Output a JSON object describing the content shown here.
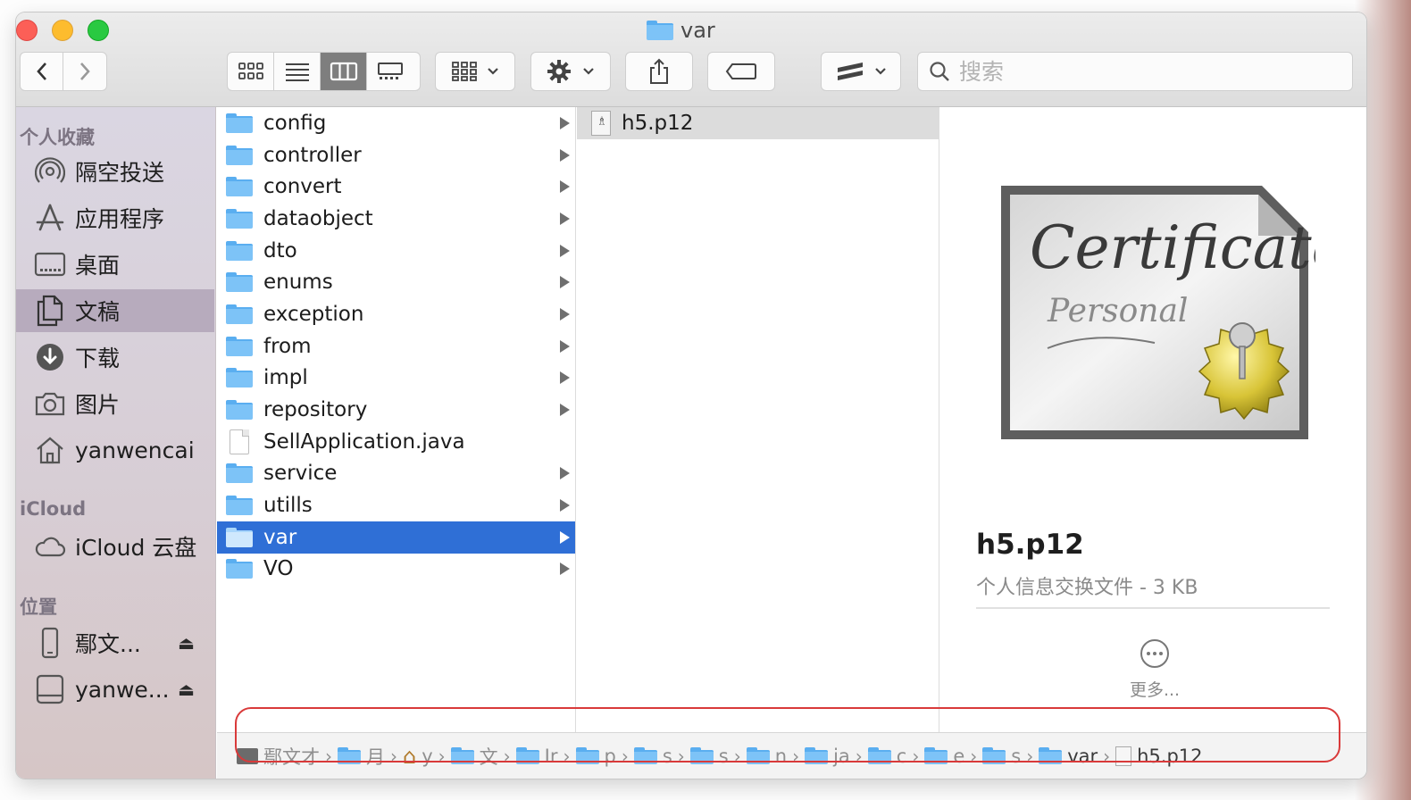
{
  "window": {
    "title": "var"
  },
  "toolbar": {
    "back_icon": "chevron-left-icon",
    "forward_icon": "chevron-right-icon",
    "search_placeholder": "搜索"
  },
  "sidebar": {
    "favorites_header": "个人收藏",
    "favorites": [
      {
        "label": "隔空投送",
        "icon": "airdrop-icon"
      },
      {
        "label": "应用程序",
        "icon": "applications-icon"
      },
      {
        "label": "桌面",
        "icon": "desktop-icon"
      },
      {
        "label": "文稿",
        "icon": "documents-icon",
        "selected": true
      },
      {
        "label": "下载",
        "icon": "downloads-icon"
      },
      {
        "label": "图片",
        "icon": "camera-icon"
      },
      {
        "label": "yanwencai",
        "icon": "home-icon"
      }
    ],
    "icloud_header": "iCloud",
    "icloud": [
      {
        "label": "iCloud 云盘",
        "icon": "cloud-icon"
      }
    ],
    "locations_header": "位置",
    "locations": [
      {
        "label": "鄢文...",
        "icon": "iphone-icon",
        "eject": "⏏"
      },
      {
        "label": "yanwe...",
        "icon": "disk-icon",
        "eject": "⏏"
      }
    ]
  },
  "column1": {
    "items": [
      {
        "label": "config",
        "type": "folder"
      },
      {
        "label": "controller",
        "type": "folder"
      },
      {
        "label": "convert",
        "type": "folder"
      },
      {
        "label": "dataobject",
        "type": "folder"
      },
      {
        "label": "dto",
        "type": "folder"
      },
      {
        "label": "enums",
        "type": "folder"
      },
      {
        "label": "exception",
        "type": "folder"
      },
      {
        "label": "from",
        "type": "folder"
      },
      {
        "label": "impl",
        "type": "folder"
      },
      {
        "label": "repository",
        "type": "folder"
      },
      {
        "label": "SellApplication.java",
        "type": "file"
      },
      {
        "label": "service",
        "type": "folder"
      },
      {
        "label": "utills",
        "type": "folder"
      },
      {
        "label": "var",
        "type": "folder",
        "selected": true
      },
      {
        "label": "VO",
        "type": "folder"
      }
    ]
  },
  "column2": {
    "items": [
      {
        "label": "h5.p12",
        "type": "certificate"
      }
    ]
  },
  "preview": {
    "filename": "h5.p12",
    "info": "个人信息交换文件 - 3 KB",
    "cert_title": "Certificate",
    "cert_subtitle": "Personal",
    "more_label": "更多..."
  },
  "pathbar": {
    "crumbs": [
      {
        "label": "鄢文才",
        "icon": "computer-icon"
      },
      {
        "label": "月",
        "icon": "folder-icon"
      },
      {
        "label": "y",
        "icon": "home-icon"
      },
      {
        "label": "文",
        "icon": "documents-icon"
      },
      {
        "label": "Ir",
        "icon": "folder-icon"
      },
      {
        "label": "p",
        "icon": "folder-icon"
      },
      {
        "label": "s",
        "icon": "folder-icon"
      },
      {
        "label": "s",
        "icon": "folder-icon"
      },
      {
        "label": "n",
        "icon": "folder-icon"
      },
      {
        "label": "ja",
        "icon": "folder-icon"
      },
      {
        "label": "c",
        "icon": "folder-icon"
      },
      {
        "label": "e",
        "icon": "folder-icon"
      },
      {
        "label": "s",
        "icon": "folder-icon"
      },
      {
        "label": "var",
        "icon": "folder-icon"
      },
      {
        "label": "h5.p12",
        "icon": "certificate-icon"
      }
    ]
  },
  "colors": {
    "selection_blue": "#2f6fd6",
    "folder_blue": "#7dc3f7",
    "highlight_red": "#d93a3a",
    "sidebar_selected": "#b7abbd"
  }
}
